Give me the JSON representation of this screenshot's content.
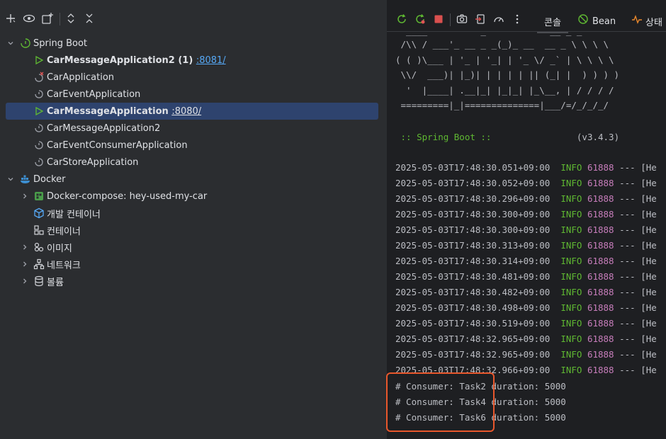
{
  "toolbar": {
    "icons": [
      "add-icon",
      "eye-icon",
      "new-group-icon",
      "expand-icon",
      "collapse-icon"
    ]
  },
  "tree": {
    "spring_boot": {
      "label": "Spring Boot",
      "apps": [
        {
          "name": "CarMessageApplication2 (1)",
          "port": ":8081/",
          "status": "running",
          "bold": true
        },
        {
          "name": "CarApplication",
          "port": "",
          "status": "error",
          "bold": false
        },
        {
          "name": "CarEventApplication",
          "port": "",
          "status": "idle",
          "bold": false
        },
        {
          "name": "CarMessageApplication",
          "port": ":8080/",
          "status": "running",
          "bold": true,
          "selected": true
        },
        {
          "name": "CarMessageApplication2",
          "port": "",
          "status": "idle",
          "bold": false
        },
        {
          "name": "CarEventConsumerApplication",
          "port": "",
          "status": "idle",
          "bold": false
        },
        {
          "name": "CarStoreApplication",
          "port": "",
          "status": "idle",
          "bold": false
        }
      ]
    },
    "docker": {
      "label": "Docker",
      "items": [
        {
          "label": "Docker-compose: hey-used-my-car",
          "expandable": true
        },
        {
          "label": "개발 컨테이너",
          "expandable": false
        },
        {
          "label": "컨테이너",
          "expandable": false
        },
        {
          "label": "이미지",
          "expandable": true
        },
        {
          "label": "네트워크",
          "expandable": true
        },
        {
          "label": "볼륨",
          "expandable": true
        }
      ]
    }
  },
  "console_toolbar": {
    "tabs": [
      {
        "label": "콘솔",
        "active": true
      },
      {
        "label": "Bean",
        "active": false
      },
      {
        "label": "상태",
        "active": false
      }
    ]
  },
  "console": {
    "banner": [
      "  ____          _            __ _ _",
      " /\\\\ / ___'_ __ _ _(_)_ __  __ _ \\ \\ \\ \\",
      "( ( )\\___ | '_ | '_| | '_ \\/ _` | \\ \\ \\ \\",
      " \\\\/  ___)| |_)| | | | | || (_| |  ) ) ) )",
      "  '  |____| .__|_| |_|_| |_\\__, | / / / /",
      " =========|_|==============|___/=/_/_/_/"
    ],
    "spring_label": " :: Spring Boot :: ",
    "spring_version": "(v3.4.3)",
    "log_lines": [
      {
        "ts": "2025-05-03T17:48:30.051+09:00",
        "level": "INFO",
        "pid": "61888",
        "rest": "--- [He"
      },
      {
        "ts": "2025-05-03T17:48:30.052+09:00",
        "level": "INFO",
        "pid": "61888",
        "rest": "--- [He"
      },
      {
        "ts": "2025-05-03T17:48:30.296+09:00",
        "level": "INFO",
        "pid": "61888",
        "rest": "--- [He"
      },
      {
        "ts": "2025-05-03T17:48:30.300+09:00",
        "level": "INFO",
        "pid": "61888",
        "rest": "--- [He"
      },
      {
        "ts": "2025-05-03T17:48:30.300+09:00",
        "level": "INFO",
        "pid": "61888",
        "rest": "--- [He"
      },
      {
        "ts": "2025-05-03T17:48:30.313+09:00",
        "level": "INFO",
        "pid": "61888",
        "rest": "--- [He"
      },
      {
        "ts": "2025-05-03T17:48:30.314+09:00",
        "level": "INFO",
        "pid": "61888",
        "rest": "--- [He"
      },
      {
        "ts": "2025-05-03T17:48:30.481+09:00",
        "level": "INFO",
        "pid": "61888",
        "rest": "--- [He"
      },
      {
        "ts": "2025-05-03T17:48:30.482+09:00",
        "level": "INFO",
        "pid": "61888",
        "rest": "--- [He"
      },
      {
        "ts": "2025-05-03T17:48:30.498+09:00",
        "level": "INFO",
        "pid": "61888",
        "rest": "--- [He"
      },
      {
        "ts": "2025-05-03T17:48:30.519+09:00",
        "level": "INFO",
        "pid": "61888",
        "rest": "--- [He"
      },
      {
        "ts": "2025-05-03T17:48:32.965+09:00",
        "level": "INFO",
        "pid": "61888",
        "rest": "--- [He"
      },
      {
        "ts": "2025-05-03T17:48:32.965+09:00",
        "level": "INFO",
        "pid": "61888",
        "rest": "--- [He"
      },
      {
        "ts": "2025-05-03T17:48:32.966+09:00",
        "level": "INFO",
        "pid": "61888",
        "rest": "--- [He"
      }
    ],
    "consumer_lines": [
      "# Consumer: Task2 duration: 5000",
      "# Consumer: Task4 duration: 5000",
      "# Consumer: Task6 duration: 5000"
    ]
  },
  "colors": {
    "accent_highlight": "#e8572c",
    "selection": "#2e436e",
    "info": "#5fb832",
    "pid": "#c77dbb",
    "port_link": "#56a8f5"
  }
}
